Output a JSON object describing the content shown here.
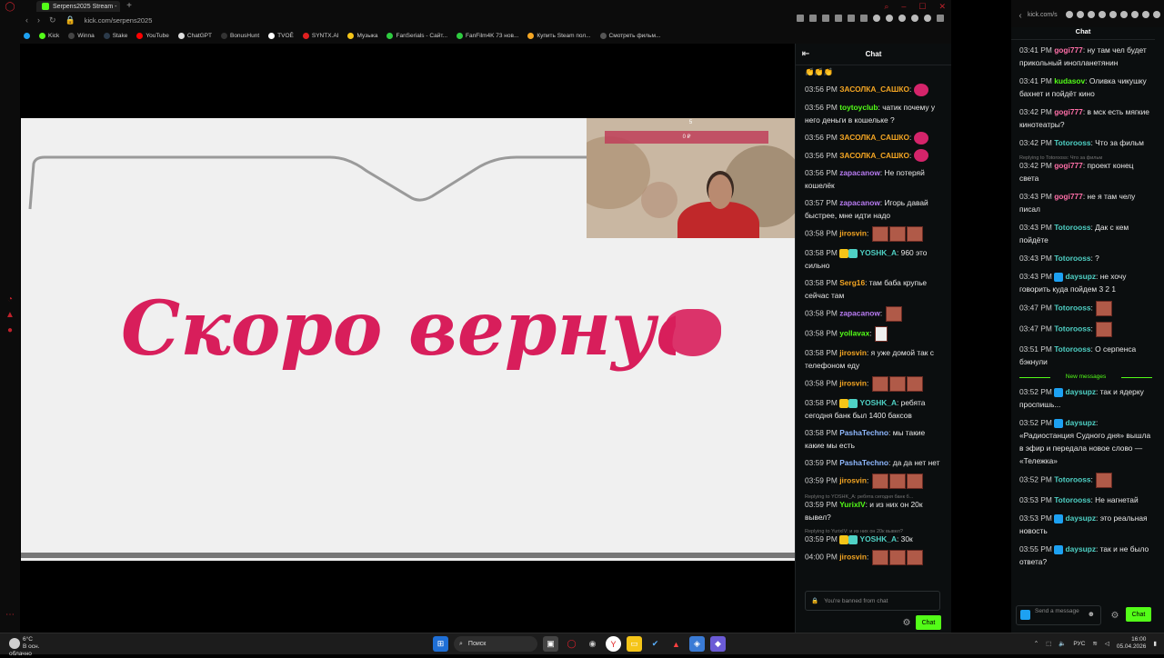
{
  "browser": {
    "tab_title": "Serpens2025 Stream -",
    "url": "kick.com/serpens2025",
    "bookmarks": [
      "Kick",
      "Winna",
      "Stake",
      "YouTube",
      "ChatGPT",
      "BonusHunt",
      "TVOĒ",
      "SYNTX.AI",
      "Музыка",
      "FanSerials - Сайт...",
      "FanFilm4K 73 нов...",
      "Купить Steam пол...",
      "Смотреть фильм..."
    ]
  },
  "stream": {
    "banner_text": "Скоро вернусь!",
    "cam_title": "5",
    "cam_bar_text": "0 ₽"
  },
  "chat": {
    "title": "Chat",
    "messages": [
      {
        "time": "",
        "user": "",
        "text": "👏👏👏",
        "color": "#e8e8e8"
      },
      {
        "time": "03:56 PM",
        "user": "ЗАСОЛКА_САШКО",
        "text": "",
        "color": "#f5a623",
        "emote": "kiss"
      },
      {
        "time": "03:56 PM",
        "user": "toytoyclub",
        "text": "чатик почему у него деньги в кошельке ?",
        "color": "#53fc18"
      },
      {
        "time": "03:56 PM",
        "user": "ЗАСОЛКА_САШКО",
        "text": "",
        "color": "#f5a623",
        "emote": "kiss"
      },
      {
        "time": "03:56 PM",
        "user": "ЗАСОЛКА_САШКО",
        "text": "",
        "color": "#f5a623",
        "emote": "kiss"
      },
      {
        "time": "03:56 PM",
        "user": "zapacanow",
        "text": "Не потеряй кошелёк",
        "color": "#b97cf3"
      },
      {
        "time": "03:57 PM",
        "user": "zapacanow",
        "text": "Игорь давай быстрее, мне идти надо",
        "color": "#b97cf3"
      },
      {
        "time": "03:58 PM",
        "user": "jirosvin",
        "text": "",
        "color": "#f5a623",
        "emote": "face3"
      },
      {
        "time": "03:58 PM",
        "user": "YOSHK_A",
        "text": "960 это сильно",
        "color": "#4fd1c5",
        "badges": true
      },
      {
        "time": "03:58 PM",
        "user": "Serg16",
        "text": "там баба крупье сейчас там",
        "color": "#f5a623"
      },
      {
        "time": "03:58 PM",
        "user": "zapacanow",
        "text": "",
        "color": "#b97cf3",
        "emote": "face1"
      },
      {
        "time": "03:58 PM",
        "user": "yollavax",
        "text": "",
        "color": "#53fc18",
        "emote": "small"
      },
      {
        "time": "03:58 PM",
        "user": "jirosvin",
        "text": "я уже домой так с телефоном еду",
        "color": "#f5a623"
      },
      {
        "time": "03:58 PM",
        "user": "jirosvin",
        "text": "",
        "color": "#f5a623",
        "emote": "face3"
      },
      {
        "time": "03:58 PM",
        "user": "YOSHK_A",
        "text": "ребята сегодня банк был 1400 баксов",
        "color": "#4fd1c5",
        "badges": true
      },
      {
        "time": "03:58 PM",
        "user": "PashaTechno",
        "text": "мы такие какие мы есть",
        "color": "#8fb8ff"
      },
      {
        "time": "03:59 PM",
        "user": "PashaTechno",
        "text": "да да нет нет",
        "color": "#8fb8ff"
      },
      {
        "time": "03:59 PM",
        "user": "jirosvin",
        "text": "",
        "color": "#f5a623",
        "emote": "face3"
      },
      {
        "time": "03:59 PM",
        "user": "YurixIV",
        "text": "и из них он 20к вывел?",
        "color": "#53fc18",
        "reply": "Replying to YOSHK_A: ребята сегодня банк б..."
      },
      {
        "time": "03:59 PM",
        "user": "YOSHK_A",
        "text": "30к",
        "color": "#4fd1c5",
        "badges": true,
        "reply": "Replying to YurixIV: и из них он 20к вывел?"
      },
      {
        "time": "04:00 PM",
        "user": "jirosvin",
        "text": "",
        "color": "#f5a623",
        "emote": "face3"
      }
    ],
    "input_placeholder": "You're banned from chat",
    "send_label": "Chat"
  },
  "right_chat": {
    "url": "kick.com/s",
    "title": "Chat",
    "messages": [
      {
        "time": "03:41 PM",
        "user": "gogi777",
        "text": "ну там чел будет прикольный инопланетянин",
        "color": "#ff6fa8"
      },
      {
        "time": "03:41 PM",
        "user": "kudasov",
        "text": "Оливка чикушку бахнет и пойдёт кино",
        "color": "#53fc18"
      },
      {
        "time": "03:42 PM",
        "user": "gogi777",
        "text": "в мск есть мягкие кинотеатры?",
        "color": "#ff6fa8"
      },
      {
        "time": "03:42 PM",
        "user": "Totorooss",
        "text": "Что за фильм",
        "color": "#4fd1c5"
      },
      {
        "time": "03:42 PM",
        "user": "gogi777",
        "text": "проект конец света",
        "color": "#ff6fa8",
        "reply": "Replying to Totorooss: Что за фильм"
      },
      {
        "time": "03:43 PM",
        "user": "gogi777",
        "text": "не я там челу писал",
        "color": "#ff6fa8"
      },
      {
        "time": "03:43 PM",
        "user": "Totorooss",
        "text": "Дак с кем пойдёте",
        "color": "#4fd1c5"
      },
      {
        "time": "03:43 PM",
        "user": "Totorooss",
        "text": "?",
        "color": "#4fd1c5"
      },
      {
        "time": "03:43 PM",
        "user": "daysupz",
        "text": "не хочу говорить куда пойдем 3 2 1",
        "color": "#4fd1c5",
        "badge": true
      },
      {
        "time": "03:47 PM",
        "user": "Totorooss",
        "text": "",
        "color": "#4fd1c5",
        "emote": "face1"
      },
      {
        "time": "03:47 PM",
        "user": "Totorooss",
        "text": "",
        "color": "#4fd1c5",
        "emote": "face1"
      },
      {
        "time": "03:51 PM",
        "user": "Totorooss",
        "text": "О серпенса бэкнули",
        "color": "#4fd1c5"
      }
    ],
    "new_messages_label": "New messages",
    "new_messages": [
      {
        "time": "03:52 PM",
        "user": "daysupz",
        "text": "так и ядерку проспишь...",
        "color": "#4fd1c5",
        "badge": true
      },
      {
        "time": "03:52 PM",
        "user": "daysupz",
        "text": "«Радиостанция Судного дня» вышла в эфир и передала новое слово — «Тележка»",
        "color": "#4fd1c5",
        "badge": true
      },
      {
        "time": "03:52 PM",
        "user": "Totorooss",
        "text": "",
        "color": "#4fd1c5",
        "emote": "face1"
      },
      {
        "time": "03:53 PM",
        "user": "Totorooss",
        "text": "Не нагнетай",
        "color": "#4fd1c5"
      },
      {
        "time": "03:53 PM",
        "user": "daysupz",
        "text": "это реальная новость",
        "color": "#4fd1c5",
        "badge": true
      },
      {
        "time": "03:55 PM",
        "user": "daysupz",
        "text": "так и не было ответа?",
        "color": "#4fd1c5",
        "badge": true
      }
    ],
    "input_placeholder": "Send a message",
    "send_label": "Chat"
  },
  "taskbar": {
    "weather_temp": "6°C",
    "weather_desc": "В осн. облачно",
    "search_label": "Поиск",
    "lang": "РУС",
    "time": "16:00",
    "date": "05.04.2026"
  }
}
